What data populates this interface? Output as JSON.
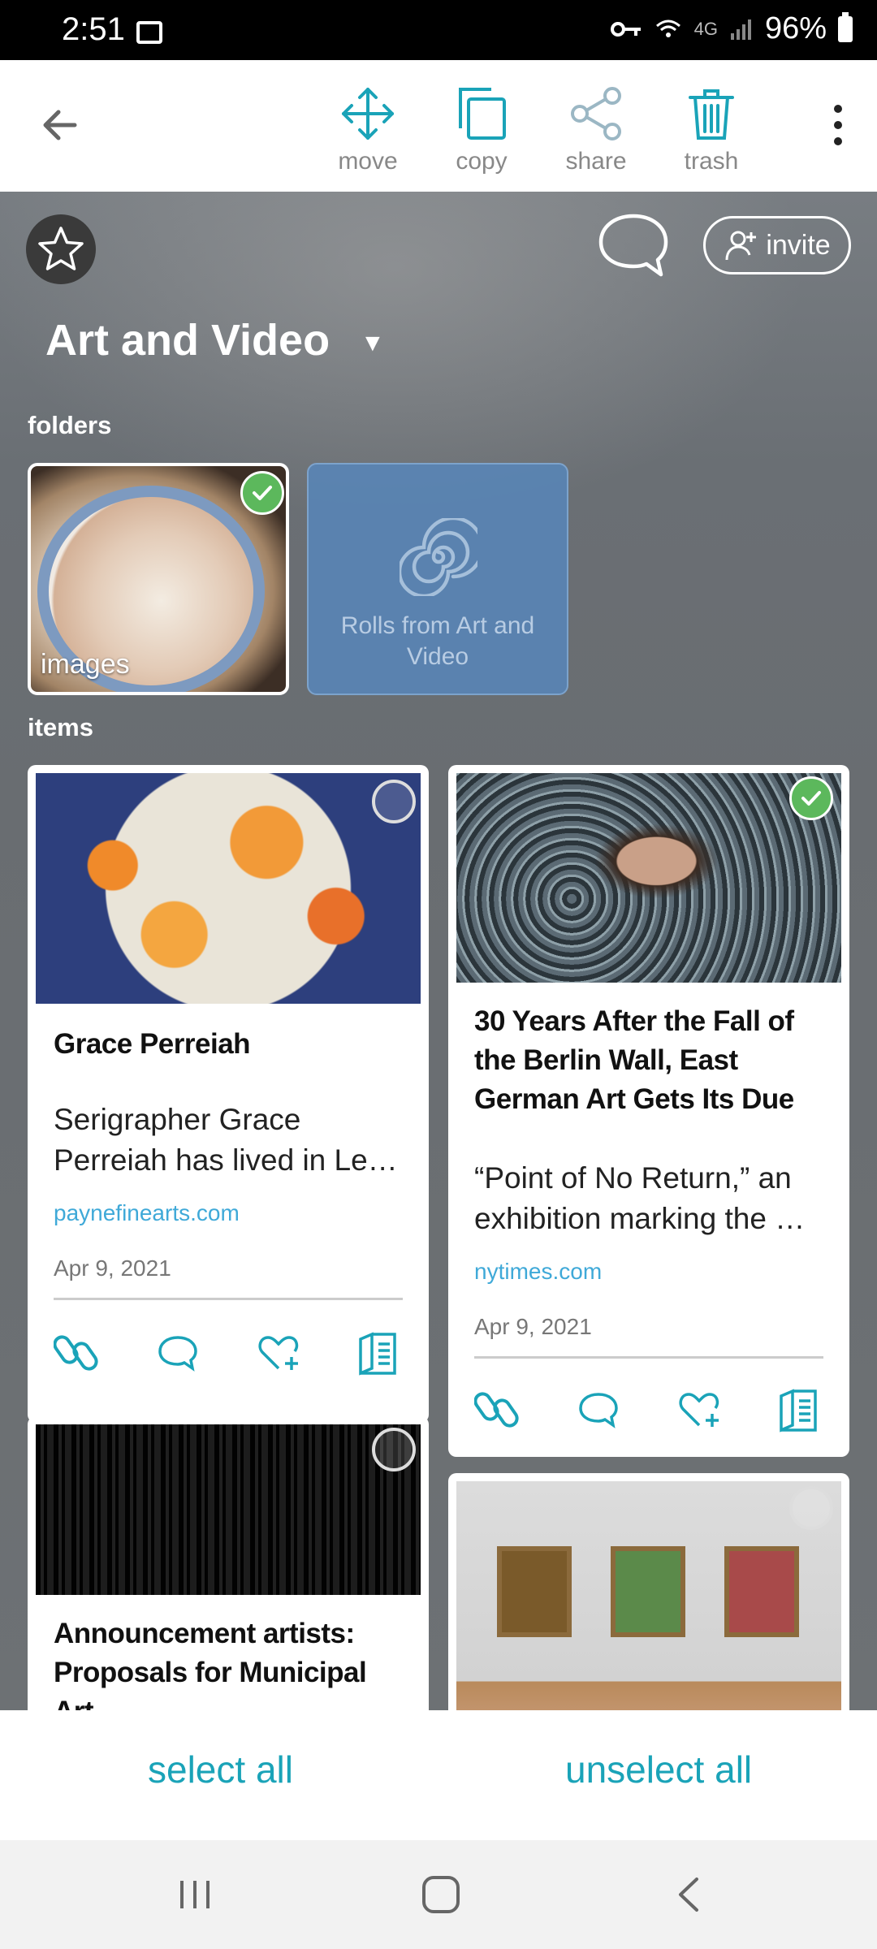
{
  "status_bar": {
    "time": "2:51",
    "network": "4G",
    "battery": "96%"
  },
  "toolbar": {
    "actions": [
      {
        "label": "move",
        "icon": "move-icon"
      },
      {
        "label": "copy",
        "icon": "copy-icon"
      },
      {
        "label": "share",
        "icon": "share-icon"
      },
      {
        "label": "trash",
        "icon": "trash-icon"
      }
    ]
  },
  "header": {
    "title": "Art and Video",
    "invite_label": "invite"
  },
  "folders": {
    "section_label": "folders",
    "items": [
      {
        "label": "images",
        "selected": true
      },
      {
        "label": "Rolls from Art and Video",
        "selected": false
      }
    ]
  },
  "items": {
    "section_label": "items",
    "cards": [
      {
        "title": "Grace Perreiah",
        "description": "Serigrapher Grace Perreiah has lived in Le…",
        "source": "paynefinearts.com",
        "date": "Apr 9, 2021",
        "selected": false
      },
      {
        "title": "30 Years After the Fall of the Berlin Wall, East German Art Gets Its Due",
        "description_line1": "“Point of No Return,” an",
        "description_line2": "exhibition marking the …",
        "source": "nytimes.com",
        "date": "Apr 9, 2021",
        "selected": true
      },
      {
        "title": "Announcement artists: Proposals for Municipal Art",
        "selected": false
      },
      {
        "title": "",
        "selected": false
      }
    ]
  },
  "bottom_actions": {
    "select_all": "select all",
    "unselect_all": "unselect all"
  },
  "colors": {
    "accent": "#1aa3b8",
    "link": "#3fa9d8",
    "check": "#5cb85c"
  }
}
